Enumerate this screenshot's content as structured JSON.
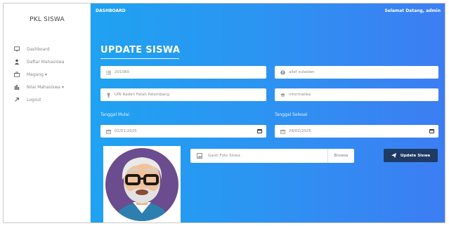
{
  "sidebar": {
    "brand": "PKL SISWA",
    "items": [
      {
        "label": "Dashboard",
        "icon": "monitor-icon"
      },
      {
        "label": "Daftar Mahasiswa",
        "icon": "user-icon"
      },
      {
        "label": "Magang ▾",
        "icon": "briefcase-icon"
      },
      {
        "label": "Nilai Mahasiswa ▾",
        "icon": "bar-chart-icon"
      },
      {
        "label": "Logout",
        "icon": "logout-icon"
      }
    ]
  },
  "topbar": {
    "title": "DASHBOARD",
    "welcome": "Selamat Datang, admin"
  },
  "form": {
    "heading": "UPDATE SISWA",
    "nis_value": "201080",
    "name_value": "allef sulaiden",
    "school_value": "UIN Raden Fatah Palembang",
    "major_value": "informatika",
    "start_label": "Tanggal Mulai",
    "end_label": "Tanggal Selesai",
    "start_value": "02/01/2025",
    "end_value": "28/02/2025",
    "photo_placeholder": "Ganti Foto Siswa",
    "browse_label": "Browse",
    "submit_label": "Update Siswa"
  },
  "colors": {
    "gradient_start": "#1fa2f1",
    "gradient_end": "#3d7df3",
    "button": "#1f3b64",
    "avatar_bg": "#6b4c8f"
  }
}
